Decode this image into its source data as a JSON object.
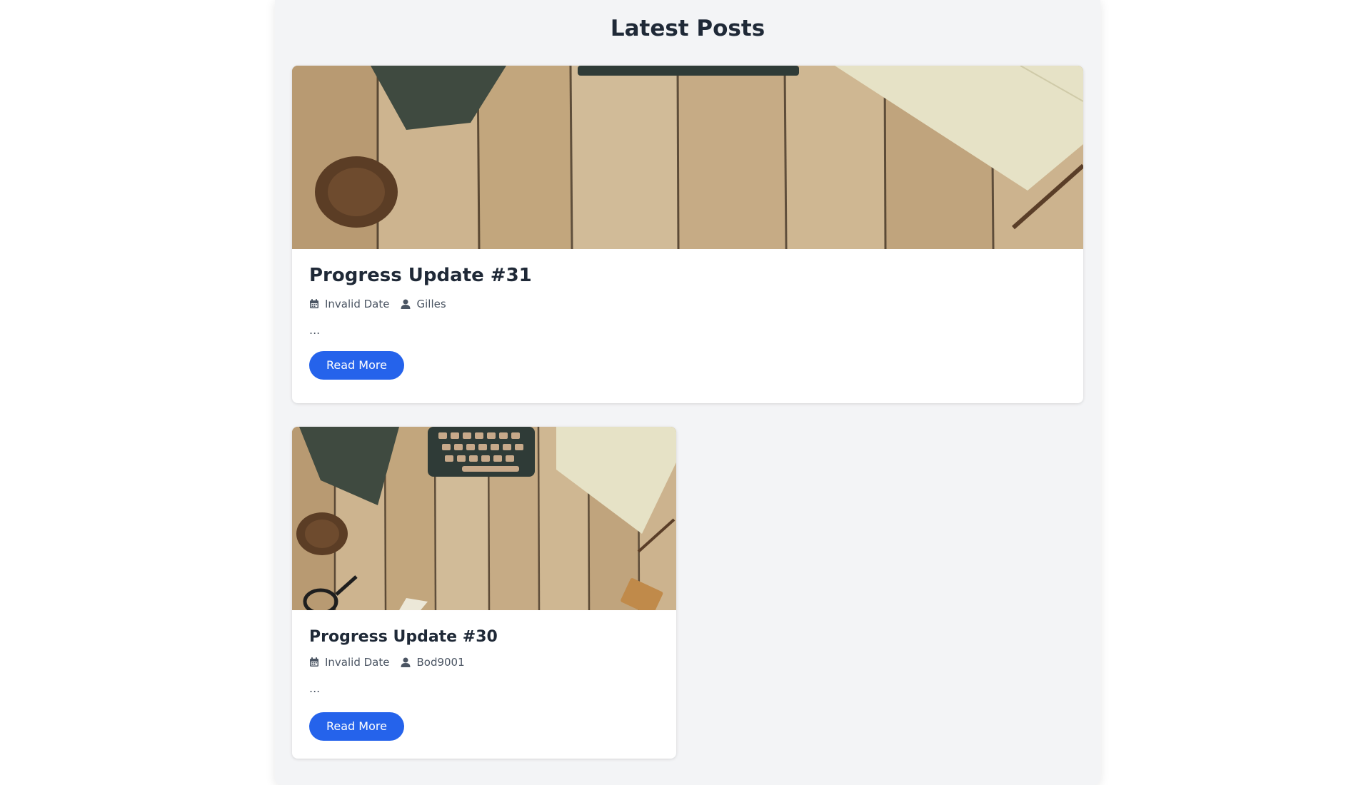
{
  "page": {
    "title": "Latest Posts"
  },
  "posts": [
    {
      "title": "Progress Update #31",
      "date": "Invalid Date",
      "author": "Gilles",
      "excerpt": "...",
      "button_label": "Read More",
      "date_icon": "calendar-icon",
      "author_icon": "user-icon"
    },
    {
      "title": "Progress Update #30",
      "date": "Invalid Date",
      "author": "Bod9001",
      "excerpt": "...",
      "button_label": "Read More",
      "date_icon": "calendar-icon",
      "author_icon": "user-icon"
    }
  ],
  "colors": {
    "page_background": "#f3f4f6",
    "card_background": "#ffffff",
    "button": "#2563eb",
    "title_text": "#1f2937",
    "meta_text": "#4b5563"
  }
}
